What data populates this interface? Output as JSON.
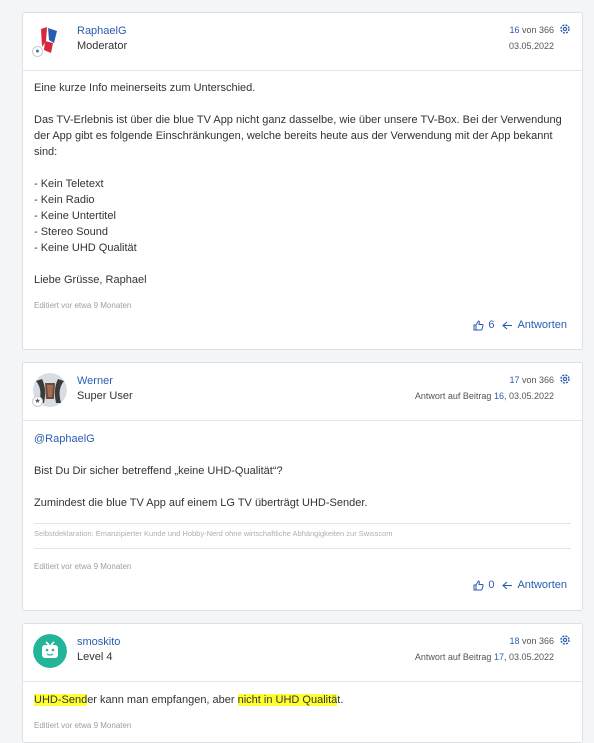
{
  "posts": [
    {
      "author": "RaphaelG",
      "rank": "Moderator",
      "count_num": "16",
      "count_rest": " von 366",
      "date": "03.05.2022",
      "lines": [
        "Eine kurze Info meinerseits zum Unterschied.",
        "Das TV-Erlebnis ist über die blue TV App nicht ganz dasselbe, wie über unsere TV-Box. Bei der Verwendung der App gibt es folgende Einschränkungen, welche bereits heute aus der Verwendung mit der App bekannt sind:",
        "- Kein Teletext",
        "- Kein Radio",
        "- Keine Untertitel",
        "- Stereo Sound",
        "- Keine UHD Qualität",
        "Liebe Grüsse, Raphael"
      ],
      "edited": "Editiert vor etwa 9 Monaten",
      "likes": "6",
      "reply_label": "Antworten"
    },
    {
      "author": "Werner",
      "rank": "Super User",
      "count_num": "17",
      "count_rest": " von 366",
      "reply_prefix": "Antwort auf Beitrag ",
      "reply_num": "16",
      "reply_date": ", 03.05.2022",
      "mention": "@RaphaelG",
      "lines": [
        "Bist Du Dir sicher betreffend „keine UHD-Qualität“?",
        "Zumindest die blue TV App auf einem LG TV überträgt UHD-Sender."
      ],
      "signature": "Selbstdeklaration: Emanzipierter Kunde und Hobby-Nerd ohne wirtschaftliche Abhängigkeiten zur Swisscom",
      "edited": "Editiert vor etwa 9 Monaten",
      "likes": "0",
      "reply_label": "Antworten"
    },
    {
      "author": "smoskito",
      "rank": "Level 4",
      "count_num": "18",
      "count_rest": " von 366",
      "reply_prefix": "Antwort auf Beitrag ",
      "reply_num": "17",
      "reply_date": ", 03.05.2022",
      "text_parts": [
        "UHD-Send",
        "er kann man empfangen, aber ",
        "nicht in UHD Qualitä",
        "t."
      ],
      "edited": "Editiert vor etwa 9 Monaten"
    }
  ],
  "colors": {
    "link": "#2a5db0",
    "highlight": "#ffff33"
  },
  "icons": [
    "gear-icon",
    "thumbs-up-icon",
    "reply-arrow-icon",
    "avatar-badge-icon"
  ]
}
